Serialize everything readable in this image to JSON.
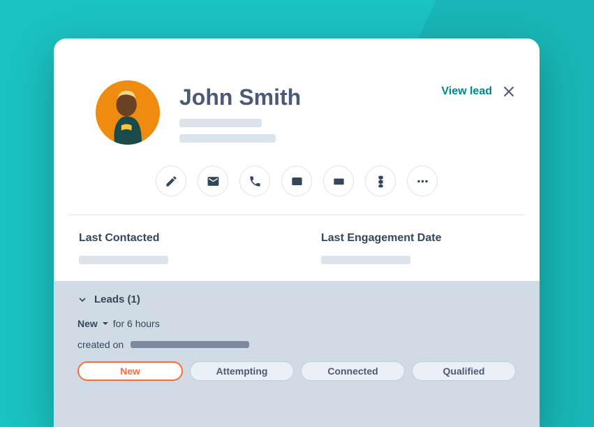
{
  "contact": {
    "name": "John Smith",
    "avatar_bg": "#f59e0b"
  },
  "header": {
    "view_lead_label": "View lead"
  },
  "actions": {
    "edit": "edit-icon",
    "email": "email-icon",
    "call": "phone-icon",
    "window": "window-icon",
    "keyboard": "keyboard-icon",
    "sequence": "sequence-icon",
    "more": "more-icon"
  },
  "meta": {
    "last_contacted_label": "Last Contacted",
    "last_engagement_label": "Last Engagement Date"
  },
  "leads": {
    "header_label": "Leads (1)",
    "status_label": "New",
    "status_duration": "for 6 hours",
    "created_label": "created on",
    "stages": [
      {
        "label": "New",
        "active": true
      },
      {
        "label": "Attempting",
        "active": false
      },
      {
        "label": "Connected",
        "active": false
      },
      {
        "label": "Qualified",
        "active": false
      }
    ]
  }
}
